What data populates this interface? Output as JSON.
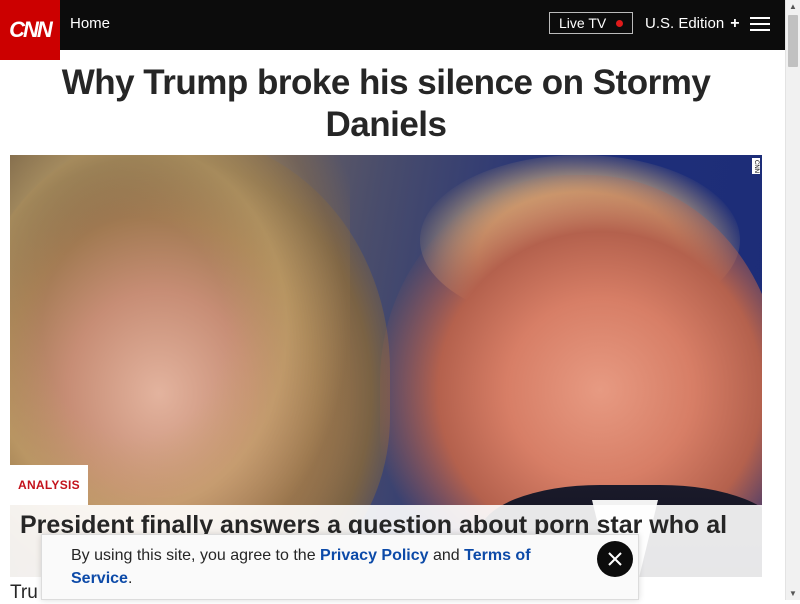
{
  "header": {
    "logo_text": "CNN",
    "home_label": "Home",
    "live_tv_label": "Live TV",
    "edition_label": "U.S. Edition",
    "edition_icon": "plus-icon",
    "menu_icon": "hamburger-menu-icon",
    "brand_color": "#cc0000"
  },
  "article": {
    "headline": "Why Trump broke his silence on Stormy Daniels",
    "image_credit": "CNN",
    "tag": "ANALYSIS",
    "hero_caption": "President finally answers a question about porn star who al",
    "body_start": "Tru"
  },
  "consent_banner": {
    "text_before": "By using this site, you agree to the ",
    "privacy_link": "Privacy Policy",
    "text_middle": " and ",
    "terms_link": "Terms of Service",
    "text_after": ".",
    "close_icon": "close-icon"
  }
}
